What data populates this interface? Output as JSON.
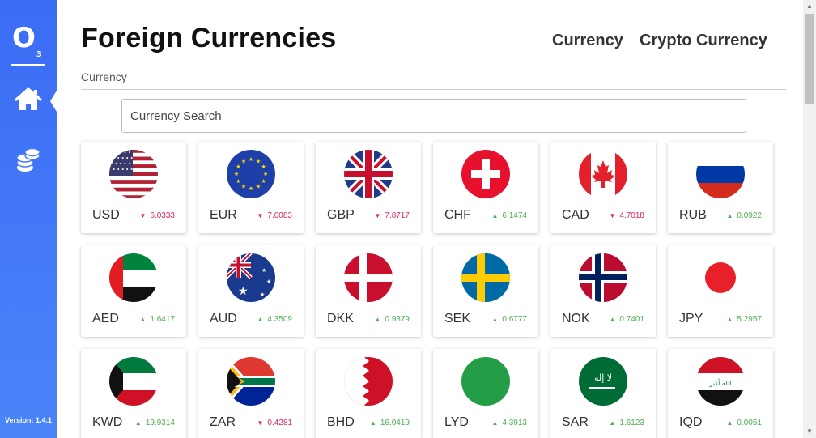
{
  "sidebar": {
    "logo_text": "O",
    "logo_sub": "3",
    "version": "Version: 1.4.1",
    "items": [
      {
        "icon": "home-icon"
      },
      {
        "icon": "coins-icon"
      }
    ]
  },
  "header": {
    "title": "Foreign Currencies",
    "tabs": [
      {
        "label": "Currency"
      },
      {
        "label": "Crypto Currency"
      }
    ],
    "breadcrumb": "Currency"
  },
  "search": {
    "placeholder": "Currency Search",
    "value": ""
  },
  "colors": {
    "down": "#e0245e",
    "up": "#4caf50",
    "sidebar": "#3b6cf6"
  },
  "currencies": [
    {
      "code": "USD",
      "value": "6.0333",
      "direction": "down",
      "flag": "usa"
    },
    {
      "code": "EUR",
      "value": "7.0083",
      "direction": "down",
      "flag": "eu"
    },
    {
      "code": "GBP",
      "value": "7.8717",
      "direction": "down",
      "flag": "uk"
    },
    {
      "code": "CHF",
      "value": "6.1474",
      "direction": "up",
      "flag": "switzerland"
    },
    {
      "code": "CAD",
      "value": "4.7018",
      "direction": "down",
      "flag": "canada"
    },
    {
      "code": "RUB",
      "value": "0.0922",
      "direction": "up",
      "flag": "russia"
    },
    {
      "code": "AED",
      "value": "1.6417",
      "direction": "up",
      "flag": "uae"
    },
    {
      "code": "AUD",
      "value": "4.3509",
      "direction": "up",
      "flag": "australia"
    },
    {
      "code": "DKK",
      "value": "0.9379",
      "direction": "up",
      "flag": "denmark"
    },
    {
      "code": "SEK",
      "value": "0.6777",
      "direction": "up",
      "flag": "sweden"
    },
    {
      "code": "NOK",
      "value": "0.7401",
      "direction": "up",
      "flag": "norway"
    },
    {
      "code": "JPY",
      "value": "5.2957",
      "direction": "up",
      "flag": "japan"
    },
    {
      "code": "KWD",
      "value": "19.9314",
      "direction": "up",
      "flag": "kuwait"
    },
    {
      "code": "ZAR",
      "value": "0.4281",
      "direction": "down",
      "flag": "south-africa"
    },
    {
      "code": "BHD",
      "value": "16.0419",
      "direction": "up",
      "flag": "bahrain"
    },
    {
      "code": "LYD",
      "value": "4.3913",
      "direction": "up",
      "flag": "libya"
    },
    {
      "code": "SAR",
      "value": "1.6123",
      "direction": "up",
      "flag": "saudi-arabia"
    },
    {
      "code": "IQD",
      "value": "0.0051",
      "direction": "up",
      "flag": "iraq"
    }
  ]
}
